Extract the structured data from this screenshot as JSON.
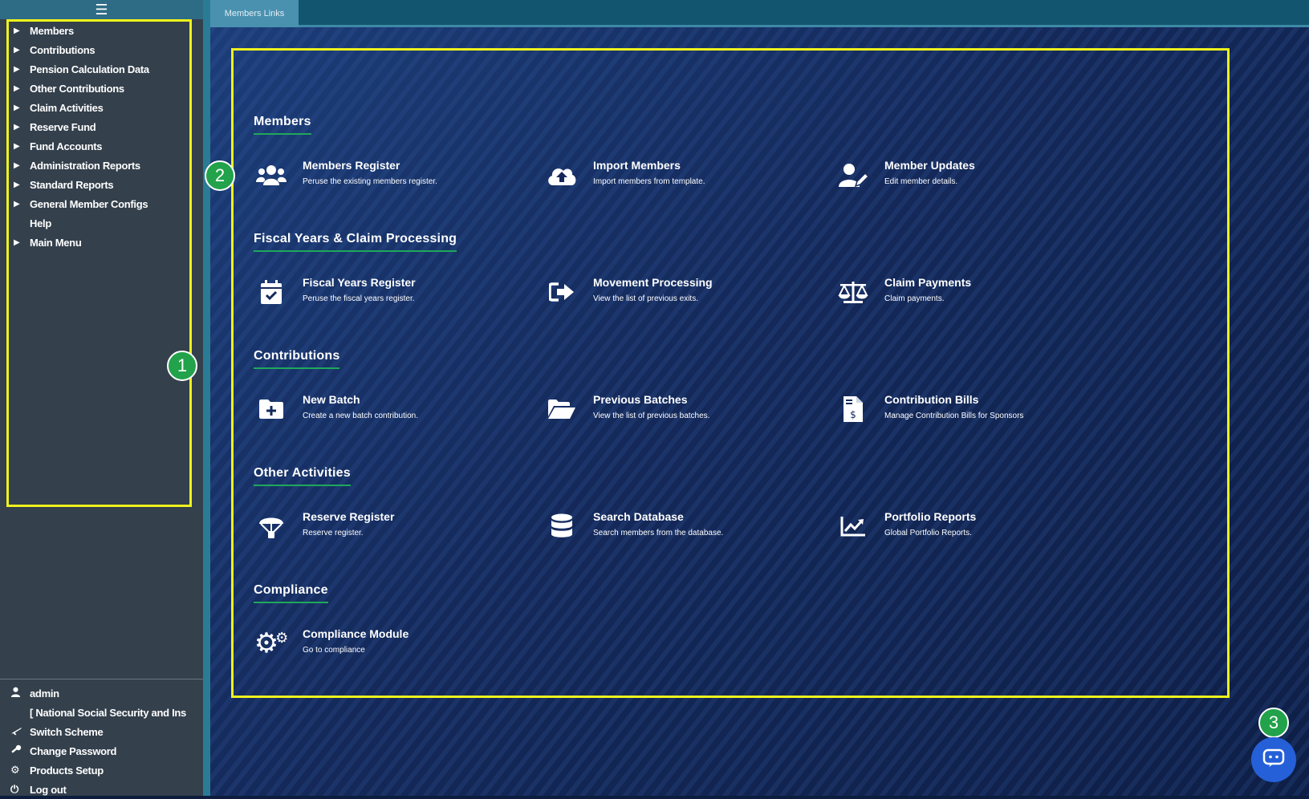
{
  "sidebar": {
    "toggle_icon": "hamburger-icon",
    "items": [
      {
        "label": "Members",
        "expandable": true
      },
      {
        "label": "Contributions",
        "expandable": true
      },
      {
        "label": "Pension Calculation Data",
        "expandable": true
      },
      {
        "label": "Other Contributions",
        "expandable": true
      },
      {
        "label": "Claim Activities",
        "expandable": true
      },
      {
        "label": "Reserve Fund",
        "expandable": true
      },
      {
        "label": "Fund Accounts",
        "expandable": true
      },
      {
        "label": "Administration Reports",
        "expandable": true
      },
      {
        "label": "Standard Reports",
        "expandable": true
      },
      {
        "label": "General Member Configs",
        "expandable": true
      },
      {
        "label": "Help",
        "expandable": false
      },
      {
        "label": "Main Menu",
        "expandable": true
      }
    ],
    "user": {
      "name": "admin",
      "scheme": "[ National Social Security and Ins",
      "switch_scheme": "Switch Scheme",
      "change_password": "Change Password",
      "products_setup": "Products Setup",
      "logout": "Log out"
    }
  },
  "tabs": [
    {
      "label": "Members Links",
      "active": true
    }
  ],
  "sections": [
    {
      "title": "Members",
      "cards": [
        {
          "title": "Members Register",
          "subtitle": "Peruse the existing members register.",
          "icon": "users-icon"
        },
        {
          "title": "Import Members",
          "subtitle": "Import members from template.",
          "icon": "cloud-upload-icon"
        },
        {
          "title": "Member Updates",
          "subtitle": "Edit member details.",
          "icon": "user-edit-icon"
        }
      ]
    },
    {
      "title": "Fiscal Years & Claim Processing",
      "cards": [
        {
          "title": "Fiscal Years Register",
          "subtitle": "Peruse the fiscal years register.",
          "icon": "calendar-check-icon"
        },
        {
          "title": "Movement Processing",
          "subtitle": "View the list of previous exits.",
          "icon": "exit-icon"
        },
        {
          "title": "Claim Payments",
          "subtitle": "Claim payments.",
          "icon": "balance-scale-icon"
        }
      ]
    },
    {
      "title": "Contributions",
      "cards": [
        {
          "title": "New Batch",
          "subtitle": "Create a new batch contribution.",
          "icon": "folder-plus-icon"
        },
        {
          "title": "Previous Batches",
          "subtitle": "View the list of previous batches.",
          "icon": "folder-open-icon"
        },
        {
          "title": "Contribution Bills",
          "subtitle": "Manage Contribution Bills for Sponsors",
          "icon": "invoice-dollar-icon"
        }
      ]
    },
    {
      "title": "Other Activities",
      "cards": [
        {
          "title": "Reserve Register",
          "subtitle": "Reserve register.",
          "icon": "parachute-icon"
        },
        {
          "title": "Search Database",
          "subtitle": "Search members from the database.",
          "icon": "database-icon"
        },
        {
          "title": "Portfolio Reports",
          "subtitle": "Global Portfolio Reports.",
          "icon": "chart-line-icon"
        }
      ]
    },
    {
      "title": "Compliance",
      "cards": [
        {
          "title": "Compliance Module",
          "subtitle": "Go to compliance",
          "icon": "cogs-icon"
        }
      ]
    }
  ],
  "markers": [
    "1",
    "2",
    "3"
  ],
  "chat": {
    "icon": "chat-icon"
  },
  "colors": {
    "accent_green": "#1fa85b",
    "highlight_yellow": "#eef21c",
    "tab_blue": "#4a91b0",
    "sidebar_bg": "#34404c"
  }
}
